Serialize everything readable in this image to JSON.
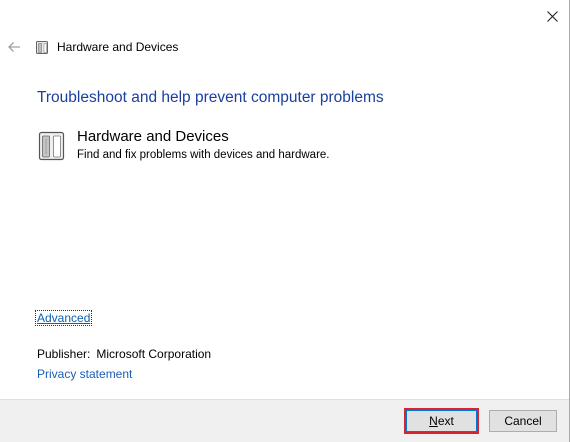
{
  "window": {
    "close_icon": "close-icon"
  },
  "header": {
    "back_icon": "back-arrow-icon",
    "title": "Hardware and Devices"
  },
  "main": {
    "heading": "Troubleshoot and help prevent computer problems",
    "item": {
      "icon": "hardware-devices-icon",
      "title": "Hardware and Devices",
      "description": "Find and fix problems with devices and hardware."
    },
    "advanced_link": "Advanced",
    "publisher_label": "Publisher:",
    "publisher_value": "Microsoft Corporation",
    "privacy_link": "Privacy statement"
  },
  "footer": {
    "next_mnemonic": "N",
    "next_rest": "ext",
    "cancel_label": "Cancel"
  },
  "colors": {
    "heading": "#1a3f9e",
    "link": "#1a5fb4",
    "highlight": "#d9232e"
  }
}
